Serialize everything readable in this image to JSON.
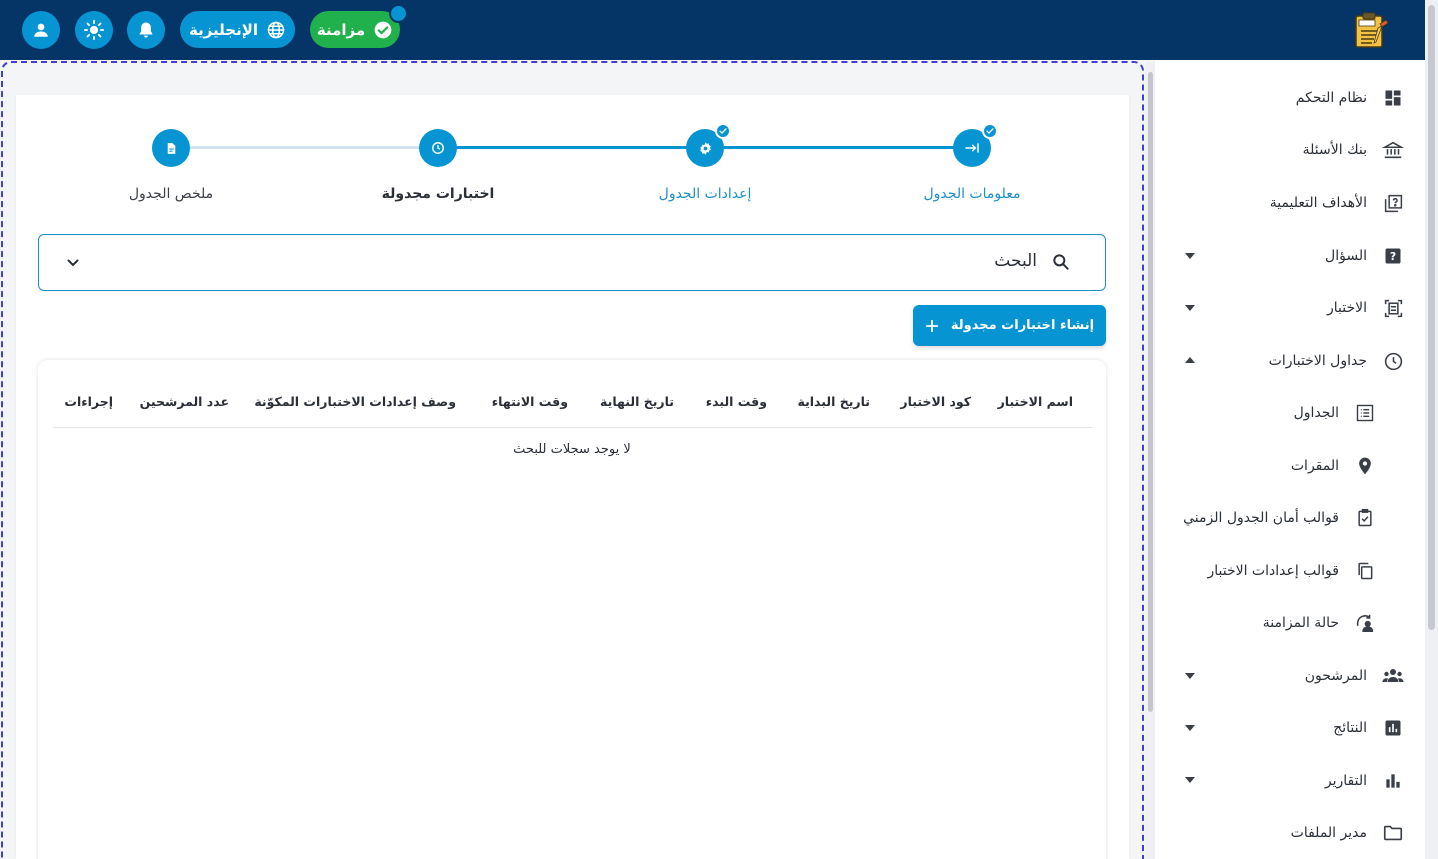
{
  "topbar": {
    "sync_label": "مزامنة",
    "language_label": "الإنجليزية",
    "colors": {
      "bar": "#053567",
      "accent": "#0794d2",
      "sync": "#21b14c"
    },
    "icons": [
      "user-icon",
      "brightness-icon",
      "bell-icon",
      "globe-icon",
      "check-circle-icon",
      "exam-logo-icon"
    ]
  },
  "sidebar": {
    "items": [
      {
        "label": "نظام التحكم",
        "icon": "dashboard-icon"
      },
      {
        "label": "بنك الأسئلة",
        "icon": "bank-icon"
      },
      {
        "label": "الأهداف التعليمية",
        "icon": "quiz-icon"
      },
      {
        "label": "السؤال",
        "icon": "question-icon"
      },
      {
        "label": "الاختبار",
        "icon": "document-scan-icon"
      },
      {
        "label": "جداول الاختبارات",
        "icon": "clock-icon"
      },
      {
        "label": "الجداول",
        "icon": "list-alt-icon"
      },
      {
        "label": "المقرات",
        "icon": "location-pin-icon"
      },
      {
        "label": "قوالب أمان الجدول الزمني",
        "icon": "clipboard-check-icon"
      },
      {
        "label": "قوالب إعدادات الاختبار",
        "icon": "copy-icon"
      },
      {
        "label": "حالة المزامنة",
        "icon": "sync-person-icon"
      },
      {
        "label": "المرشحون",
        "icon": "people-icon"
      },
      {
        "label": "النتائج",
        "icon": "bar-chart-box-icon"
      },
      {
        "label": "التقارير",
        "icon": "bar-chart-icon"
      },
      {
        "label": "مدير الملفات",
        "icon": "folder-icon"
      }
    ]
  },
  "stepper": {
    "steps": [
      {
        "label": "معلومات الجدول",
        "icon": "arrow-right-bar-icon",
        "state": "completed"
      },
      {
        "label": "إعدادات الجدول",
        "icon": "gear-icon",
        "state": "completed"
      },
      {
        "label": "اختبارات مجدولة",
        "icon": "clock-icon",
        "state": "active"
      },
      {
        "label": "ملخص الجدول",
        "icon": "document-icon",
        "state": "pending"
      }
    ]
  },
  "search": {
    "label": "البحث"
  },
  "create_button": {
    "label": "إنشاء اختبارات مجدولة"
  },
  "table": {
    "headers": [
      "اسم الاختبار",
      "كود الاختبار",
      "تاريخ البداية",
      "وقت البدء",
      "تاريخ النهاية",
      "وقت الانتهاء",
      "وصف إعدادات الاختبارات المكوّنة",
      "عدد المرشحين",
      "إجراءات"
    ],
    "empty_message": "لا يوجد سجلات للبحث"
  }
}
